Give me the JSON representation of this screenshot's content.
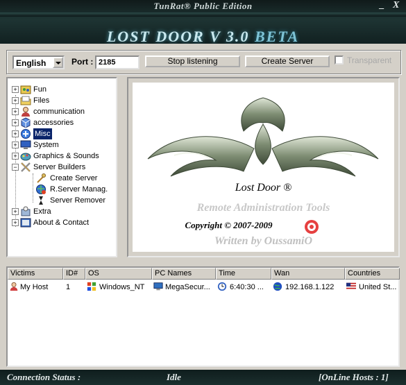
{
  "window": {
    "title": "TunRat® Public Edition",
    "minimize_label": "_",
    "close_label": "X",
    "banner_part1": "LOST DOOR V 3.0",
    "banner_part2": "BETA"
  },
  "toolbar": {
    "language_selected": "English",
    "port_label": "Port :",
    "port_value": "2185",
    "stop_button": "Stop listening",
    "create_button": "Create Server",
    "transparent_label": "Transparent",
    "transparent_checked": false
  },
  "tree": {
    "items": [
      {
        "label": "Fun",
        "icon": "fun-icon",
        "expander": "+"
      },
      {
        "label": "Files",
        "icon": "files-icon",
        "expander": "+"
      },
      {
        "label": "communication",
        "icon": "communication-icon",
        "expander": "+"
      },
      {
        "label": "accessories",
        "icon": "accessories-icon",
        "expander": "+"
      },
      {
        "label": "Misc",
        "icon": "misc-icon",
        "expander": "+",
        "selected": true
      },
      {
        "label": "System",
        "icon": "system-icon",
        "expander": "+"
      },
      {
        "label": "Graphics & Sounds",
        "icon": "graphics-sounds-icon",
        "expander": "+"
      },
      {
        "label": "Server Builders",
        "icon": "server-builders-icon",
        "expander": "−"
      },
      {
        "label": "Create Server",
        "icon": "create-server-icon",
        "child": true
      },
      {
        "label": "R.Server Manag.",
        "icon": "rserver-manager-icon",
        "child": true
      },
      {
        "label": "Server Remover",
        "icon": "server-remover-icon",
        "child": true
      },
      {
        "label": "Extra",
        "icon": "extra-icon",
        "expander": "+"
      },
      {
        "label": "About & Contact",
        "icon": "about-contact-icon",
        "expander": "+"
      }
    ]
  },
  "splash": {
    "product_name": "Lost Door ®",
    "tagline": "Remote Administration Tools",
    "copyright": "Copyright © 2007-2009",
    "author": "Written by OussamiO"
  },
  "victims_table": {
    "columns": [
      "Victims",
      "ID#",
      "OS",
      "PC Names",
      "Time",
      "Wan",
      "Countries"
    ],
    "rows": [
      {
        "victim": "My Host",
        "id": "1",
        "os": "Windows_NT",
        "pc_name": "MegaSecur...",
        "time": "6:40:30 ...",
        "wan": "192.168.1.122",
        "country": "United St..."
      }
    ]
  },
  "status": {
    "connection_label": "Connection Status :",
    "connection_value": "Idle",
    "hosts_label": "[OnLine Hosts : 1]"
  },
  "colors": {
    "selection": "#0a246a",
    "chrome_dark": "#1e3433",
    "banner": "#7ec3d6"
  }
}
